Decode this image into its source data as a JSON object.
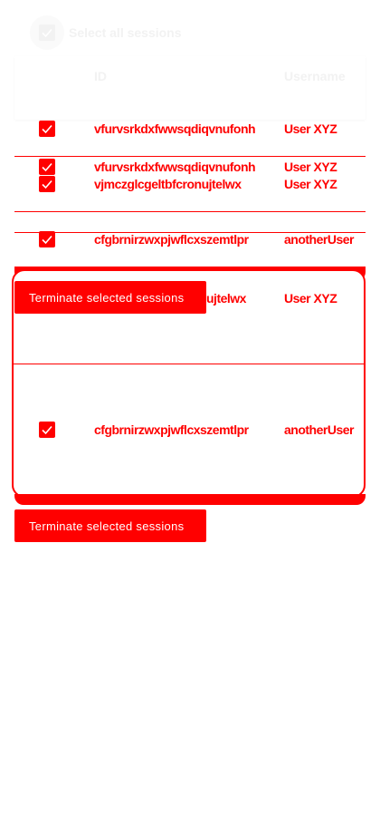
{
  "select_all": {
    "label": "Select all sessions"
  },
  "table": {
    "columns": [
      "ID",
      "Username"
    ],
    "rows": [
      {
        "id": "vfurvsrkdxfwwsqdiqvnufonh",
        "username": "User XYZ"
      },
      {
        "id": "vfurvsrkdxfwwsqdiqvnufonh",
        "username": "User XYZ"
      },
      {
        "id": "vjmczglcgeltbfcronujtelwx",
        "username": "User XYZ"
      },
      {
        "id": "cfgbrnirzwxpjwflcxszemtlpr",
        "username": "anotherUser"
      },
      {
        "id": "ujtelwx",
        "username": "User XYZ"
      },
      {
        "id": "cfgbrnirzwxpjwflcxszemtlpr",
        "username": "anotherUser"
      }
    ]
  },
  "actions": {
    "terminate_label": "Terminate selected sessions",
    "terminate_overlay_label": "Terminate selected sessions"
  },
  "colors": {
    "accent": "#ff0000",
    "faint": "#f2f2f2",
    "background": "#ffffff"
  }
}
